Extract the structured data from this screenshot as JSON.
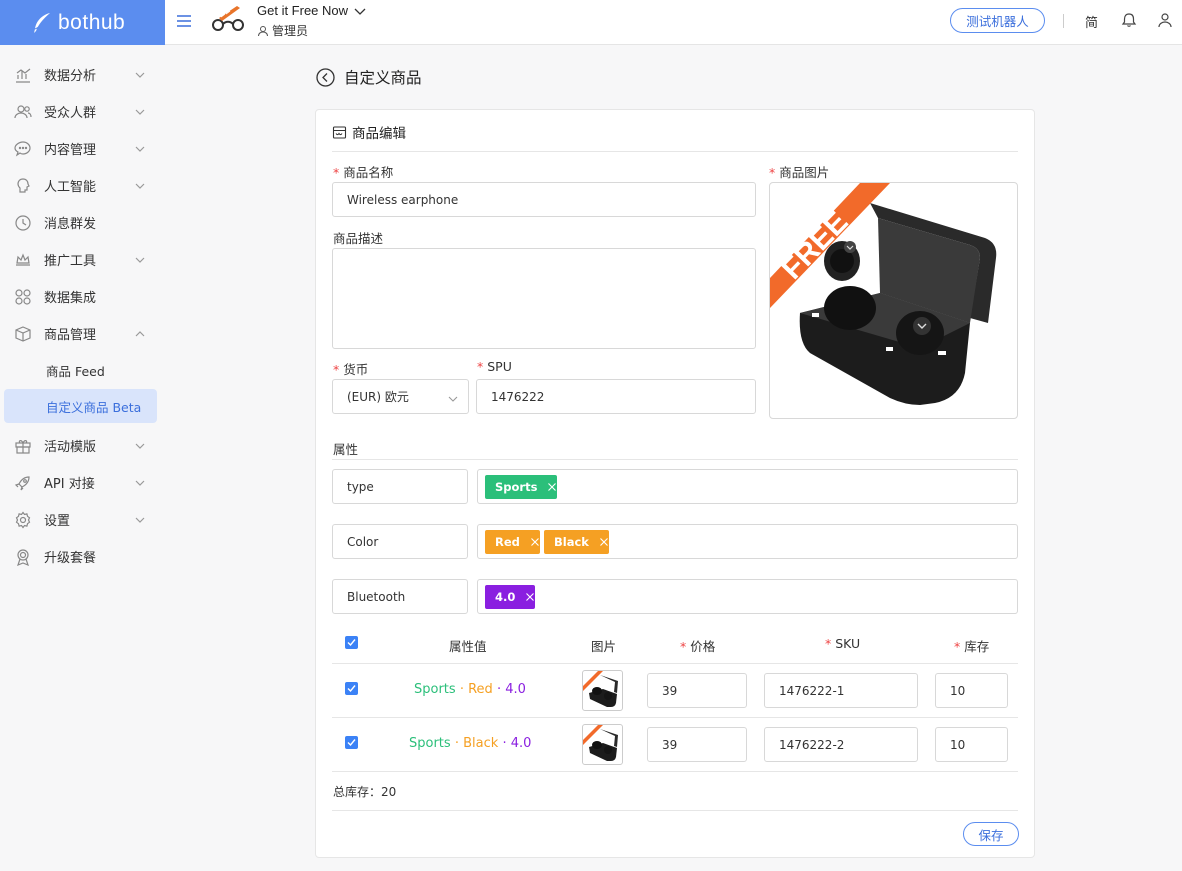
{
  "app": {
    "logo_text": "bothub",
    "title": "Get it Free Now",
    "role": "管理员",
    "test_bot_label": "测试机器人",
    "lang_label": "简"
  },
  "sidebar": {
    "items": [
      {
        "label": "数据分析",
        "icon": "bar-chart-icon",
        "expandable": true
      },
      {
        "label": "受众人群",
        "icon": "users-icon",
        "expandable": true
      },
      {
        "label": "内容管理",
        "icon": "chat-icon",
        "expandable": true
      },
      {
        "label": "人工智能",
        "icon": "brain-icon",
        "expandable": true
      },
      {
        "label": "消息群发",
        "icon": "clock-icon",
        "expandable": false
      },
      {
        "label": "推广工具",
        "icon": "crown-icon",
        "expandable": true
      },
      {
        "label": "数据集成",
        "icon": "grid-icon",
        "expandable": false
      },
      {
        "label": "商品管理",
        "icon": "box-icon",
        "expandable": true,
        "expanded": true
      },
      {
        "label": "活动模版",
        "icon": "gift-icon",
        "expandable": true
      },
      {
        "label": "API 对接",
        "icon": "rocket-icon",
        "expandable": true
      },
      {
        "label": "设置",
        "icon": "gear-icon",
        "expandable": true
      },
      {
        "label": "升级套餐",
        "icon": "award-icon",
        "expandable": false
      }
    ],
    "subitems": [
      {
        "label": "商品 Feed"
      },
      {
        "label": "自定义商品 Beta",
        "active": true
      }
    ]
  },
  "page": {
    "title": "自定义商品",
    "card_title": "商品编辑"
  },
  "form": {
    "name_label": "商品名称",
    "name_value": "Wireless earphone",
    "desc_label": "商品描述",
    "desc_value": "",
    "currency_label": "货币",
    "currency_value": "(EUR) 欧元",
    "spu_label": "SPU",
    "spu_value": "1476222",
    "image_label": "商品图片",
    "image_badge": "FREE",
    "attributes_label": "属性",
    "total_stock_label": "总库存：",
    "total_stock_value": "20",
    "save_label": "保存"
  },
  "attributes": [
    {
      "name": "type",
      "values": [
        {
          "label": "Sports",
          "color": "#2bbf7a"
        }
      ]
    },
    {
      "name": "Color",
      "values": [
        {
          "label": "Red",
          "color": "#f5a023"
        },
        {
          "label": "Black",
          "color": "#f5a023"
        }
      ]
    },
    {
      "name": "Bluetooth",
      "values": [
        {
          "label": "4.0",
          "color": "#8a1fe0"
        }
      ]
    }
  ],
  "table": {
    "headers": {
      "values": "属性值",
      "image": "图片",
      "price": "价格",
      "sku": "SKU",
      "stock": "库存"
    },
    "rows": [
      {
        "type": "Sports",
        "color": "Red",
        "bt": "4.0",
        "price": "39",
        "sku": "1476222-1",
        "stock": "10"
      },
      {
        "type": "Sports",
        "color": "Black",
        "bt": "4.0",
        "price": "39",
        "sku": "1476222-2",
        "stock": "10"
      }
    ],
    "sep": "·"
  },
  "colors": {
    "accent": "#5b8def",
    "sports": "#2bbf7a",
    "color_attr": "#f5a023",
    "bluetooth": "#8a1fe0"
  }
}
